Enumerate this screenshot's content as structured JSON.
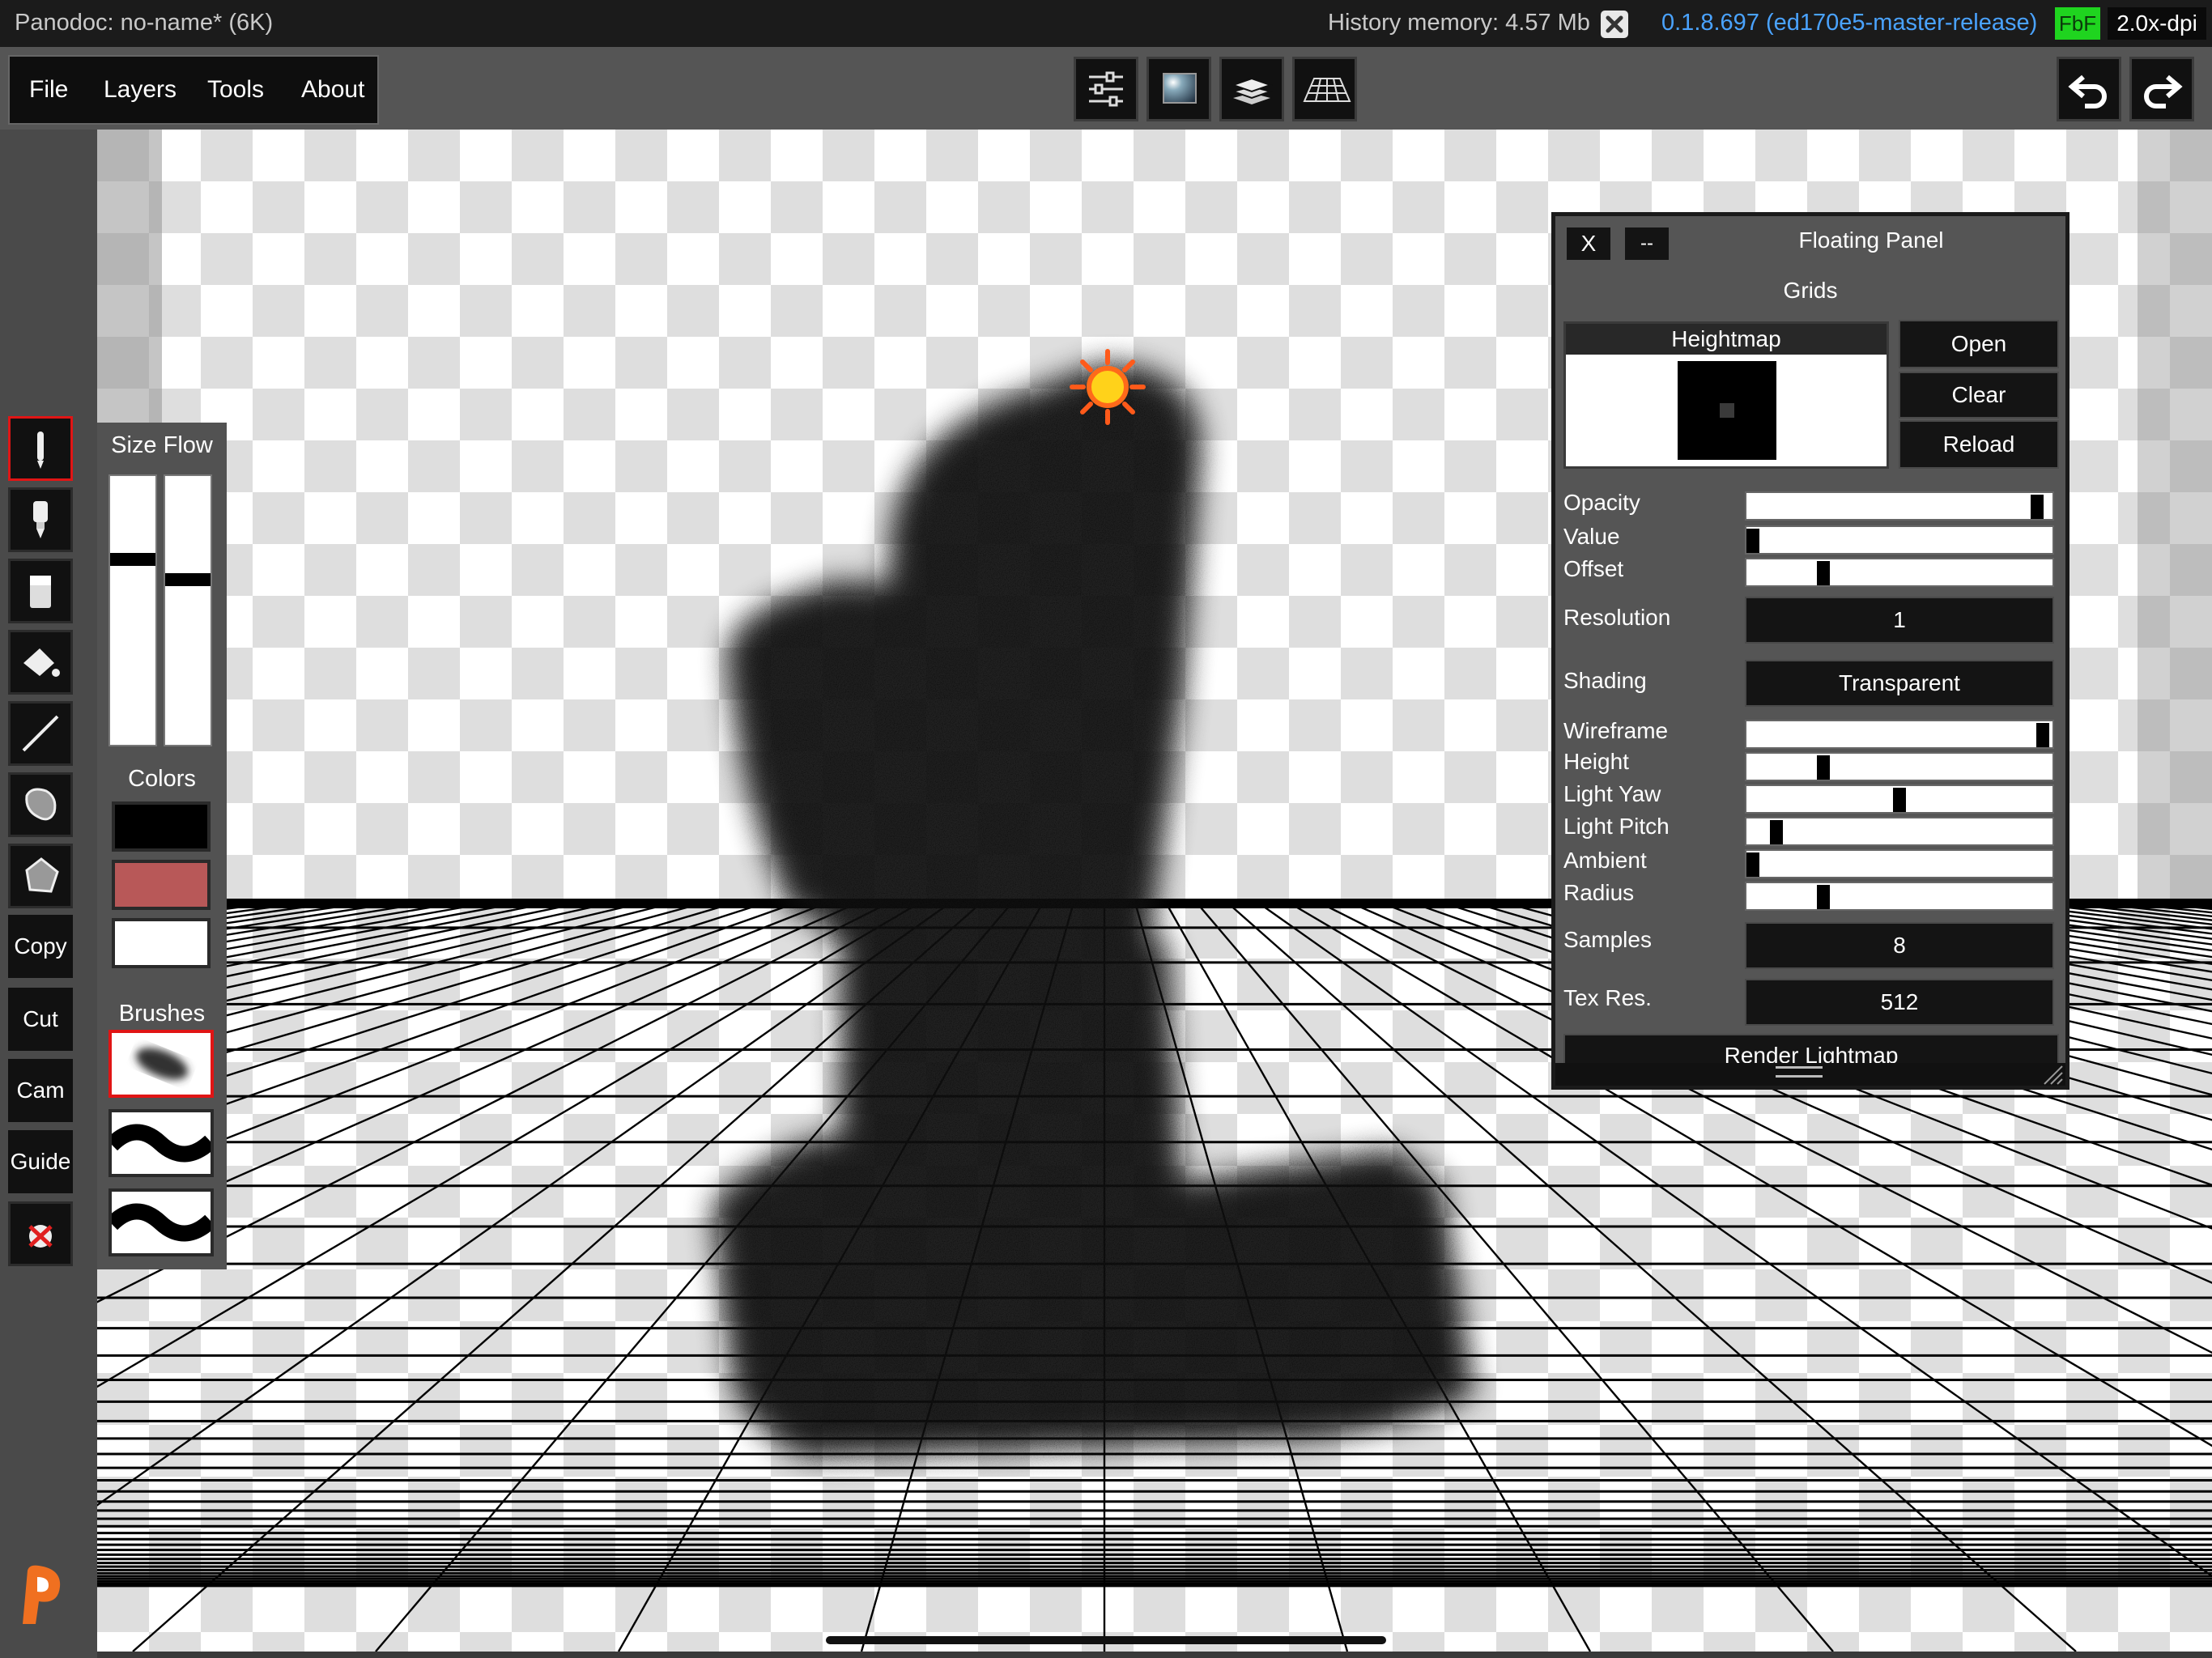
{
  "statusbar": {
    "title": "Panodoc: no-name* (6K)",
    "history_memory": "History memory: 4.57 Mb",
    "version": "0.1.8.697 (ed170e5-master-release)",
    "fbf_badge": "FbF",
    "dpi": "2.0x-dpi"
  },
  "menu": {
    "file": "File",
    "layers": "Layers",
    "tools": "Tools",
    "about": "About"
  },
  "toolbar_icons": [
    "sliders-icon",
    "image-icon",
    "layers-icon",
    "grid-icon"
  ],
  "history_icons": [
    "undo-icon",
    "redo-icon"
  ],
  "left_tools": {
    "icons": [
      "pencil-icon",
      "airbrush-icon",
      "eraser-icon",
      "fill-bucket-icon",
      "line-icon",
      "lasso-icon",
      "polygon-icon"
    ],
    "copy": "Copy",
    "cut": "Cut",
    "cam": "Cam",
    "guide": "Guide"
  },
  "brush_panel": {
    "size_flow_label": "Size Flow",
    "size_value": 0.3,
    "flow_value": 0.38,
    "colors_label": "Colors",
    "colors": [
      "#000000",
      "#b85858",
      "#ffffff"
    ],
    "brushes_label": "Brushes"
  },
  "floating_panel": {
    "close_label": "X",
    "minimize_label": "--",
    "title": "Floating Panel",
    "section": "Grids",
    "heightmap_label": "Heightmap",
    "open_label": "Open",
    "clear_label": "Clear",
    "reload_label": "Reload",
    "opacity_label": "Opacity",
    "opacity_value": 0.97,
    "value_label": "Value",
    "value_value": 0.0,
    "offset_label": "Offset",
    "offset_value": 0.24,
    "resolution_label": "Resolution",
    "resolution_value": "1",
    "shading_label": "Shading",
    "shading_value": "Transparent",
    "wireframe_label": "Wireframe",
    "wireframe_value": 0.99,
    "height_label": "Height",
    "height_value": 0.24,
    "light_yaw_label": "Light Yaw",
    "light_yaw_value": 0.5,
    "light_pitch_label": "Light Pitch",
    "light_pitch_value": 0.08,
    "ambient_label": "Ambient",
    "ambient_value": 0.0,
    "radius_label": "Radius",
    "radius_value": 0.24,
    "samples_label": "Samples",
    "samples_value": "8",
    "tex_res_label": "Tex Res.",
    "tex_res_value": "512",
    "render_label": "Render Lightmap"
  }
}
